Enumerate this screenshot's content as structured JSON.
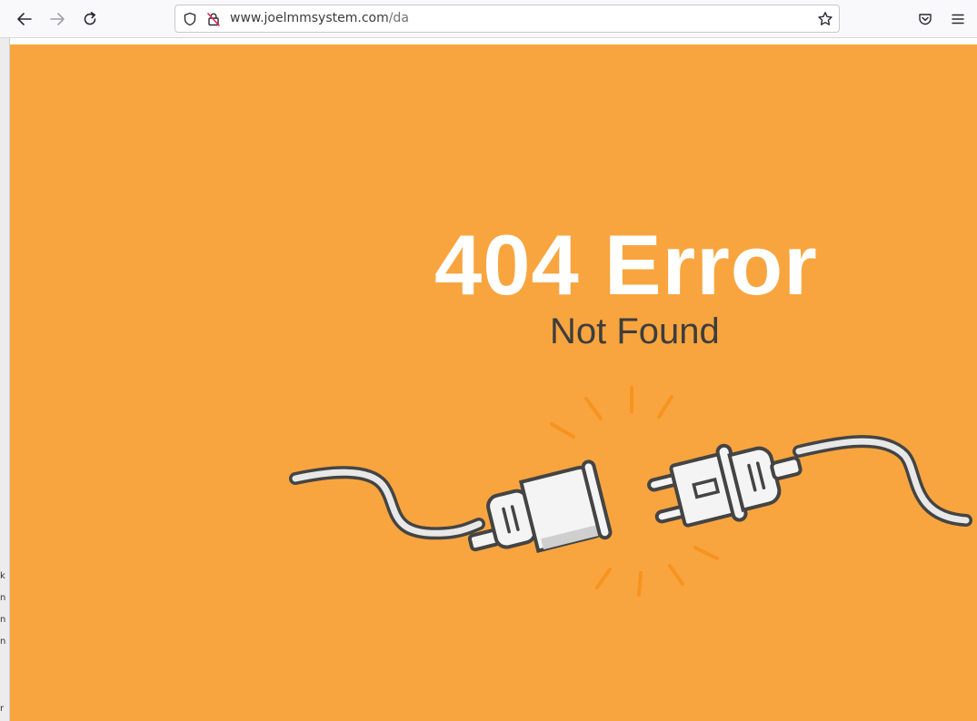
{
  "browser": {
    "url_host": "www.joelmmsystem.com",
    "url_path": "/da",
    "icons": {
      "back": "back-arrow-icon",
      "forward": "forward-arrow-icon",
      "reload": "reload-icon",
      "shield": "tracking-shield-icon",
      "insecure_lock": "insecure-lock-icon",
      "bookmark": "bookmark-star-icon",
      "pocket": "pocket-icon",
      "menu": "hamburger-menu-icon"
    }
  },
  "page": {
    "title": "404 Error",
    "subtitle": "Not Found",
    "background_color": "#f8a53f",
    "illustration": "unplugged-cable-icon"
  },
  "left_strip_fragments": [
    "k",
    "n",
    "n",
    "n",
    "r"
  ]
}
